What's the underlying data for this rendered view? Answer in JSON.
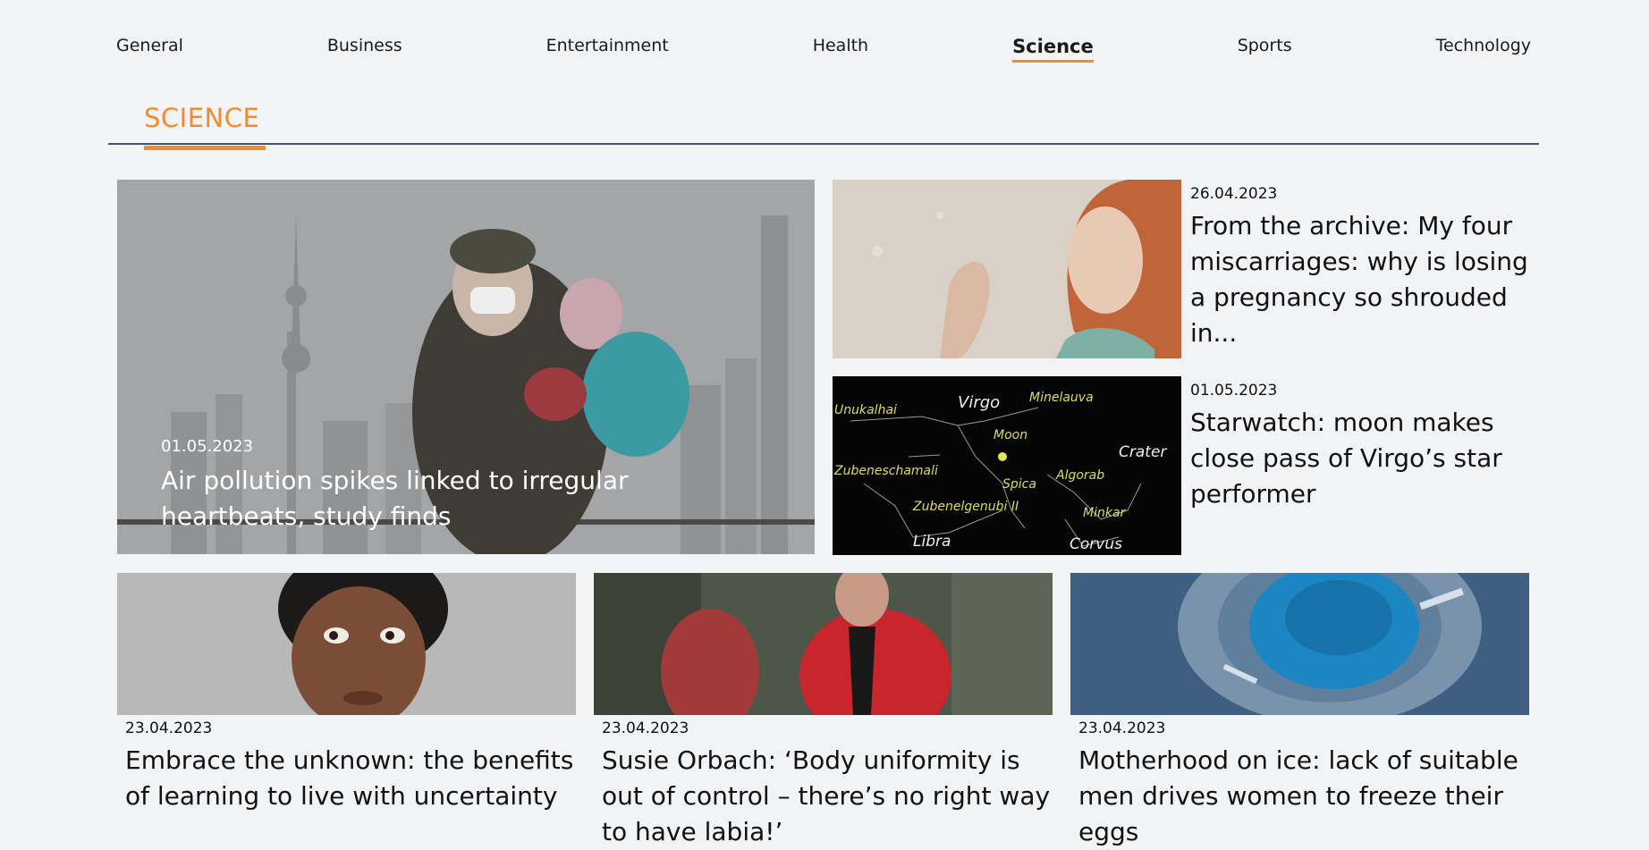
{
  "nav": {
    "items": [
      {
        "label": "General"
      },
      {
        "label": "Business"
      },
      {
        "label": "Entertainment"
      },
      {
        "label": "Health"
      },
      {
        "label": "Science"
      },
      {
        "label": "Sports"
      },
      {
        "label": "Technology"
      }
    ],
    "active": "Science"
  },
  "section": {
    "title": "SCIENCE"
  },
  "hero": {
    "date": "01.05.2023",
    "title": "Air pollution spikes linked to irregular heartbeats, study finds"
  },
  "side_articles": [
    {
      "date": "26.04.2023",
      "title": "From the archive: My four miscarriages: why is losing a pregnancy so shrouded in..."
    },
    {
      "date": "01.05.2023",
      "title": "Starwatch: moon makes close pass of Virgo’s star performer"
    }
  ],
  "constellation_labels": {
    "unukalhai": "Unukalhai",
    "virgo": "Virgo",
    "minelauva": "Minelauva",
    "moon": "Moon",
    "crater": "Crater",
    "zubeneschamali": "Zubeneschamali",
    "spica": "Spica",
    "algorab": "Algorab",
    "zubenelgenubi": "Zubenelgenubi II",
    "minkar": "Minkar",
    "libra": "Libra",
    "corvus": "Corvus"
  },
  "cards": [
    {
      "date": "23.04.2023",
      "title": "Embrace the unknown: the benefits of learning to live with uncertainty"
    },
    {
      "date": "23.04.2023",
      "title": "Susie Orbach: ‘Body uniformity is out of control – there’s no right way to have labia!’"
    },
    {
      "date": "23.04.2023",
      "title": "Motherhood on ice: lack of suitable men drives women to freeze their eggs"
    }
  ],
  "colors": {
    "accent": "#f28a2e",
    "background": "#f2f3f5",
    "rule": "#4a5160"
  }
}
